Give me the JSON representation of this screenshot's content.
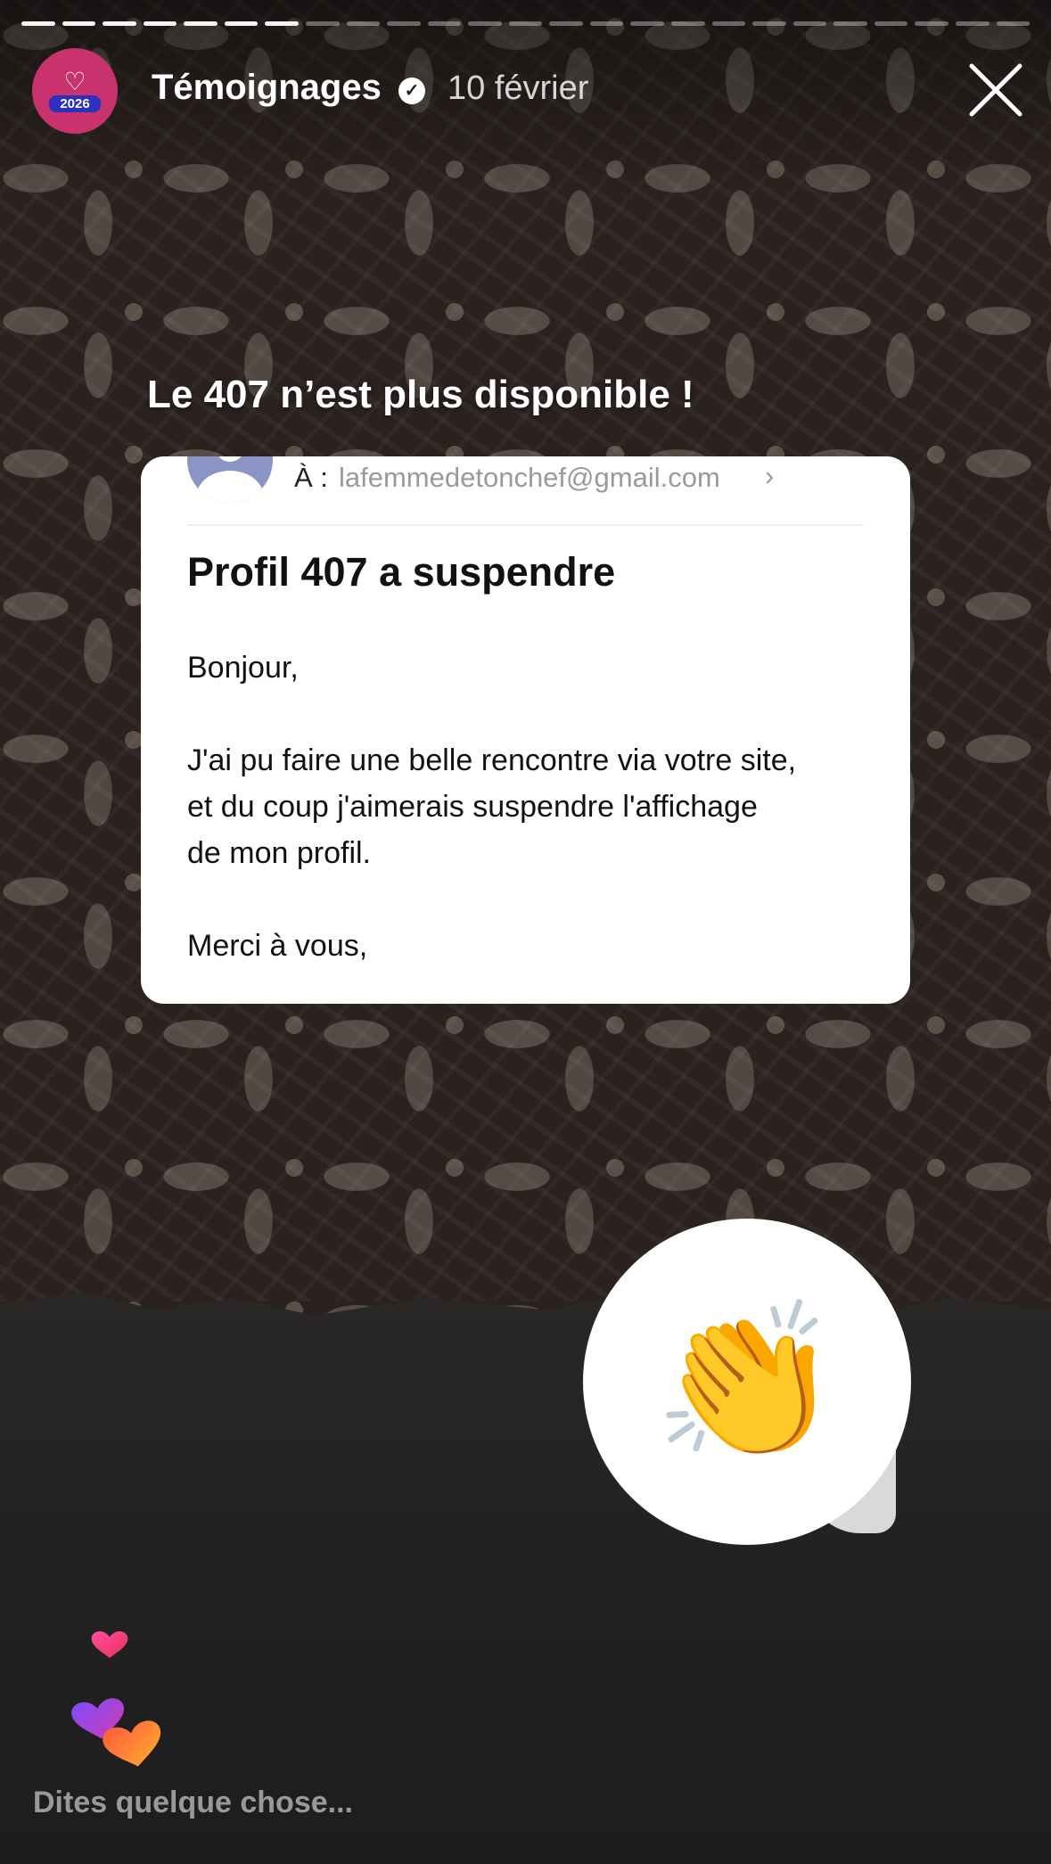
{
  "story": {
    "progress": {
      "total_segments": 25,
      "completed_segments": 7,
      "active_segment": 8
    },
    "header": {
      "avatar_text": "2026",
      "account_name": "Témoignages",
      "date": "10 février"
    },
    "caption": "Le 407 n’est plus disponible !",
    "email": {
      "to_label": "À :",
      "to_address": "lafemmedetonchef@gmail.com",
      "chevron": "›",
      "subject": "Profil 407 a suspendre",
      "greeting": "Bonjour,",
      "body_lines": [
        "J'ai pu faire une belle rencontre via votre site,",
        "et du coup j'aimerais suspendre l'affichage",
        "de mon profil."
      ],
      "closing": "Merci à vous,"
    },
    "sticker": {
      "emoji": "👏",
      "icon": "clapping-hands-icon"
    },
    "reply_placeholder": "Dites quelque chose...",
    "colors": {
      "avatar_bg": "#c8336e",
      "avatar_badge": "#2c2fbf"
    }
  }
}
